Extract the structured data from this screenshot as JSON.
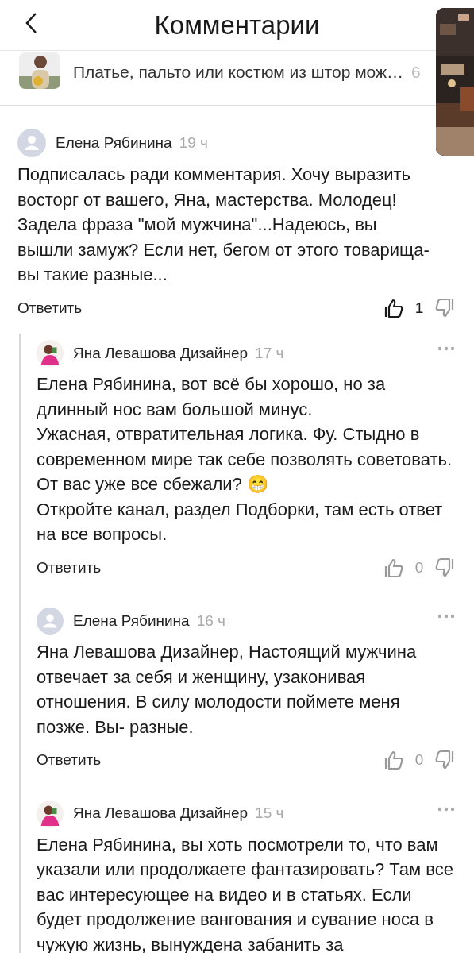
{
  "header": {
    "title": "Комментарии"
  },
  "article": {
    "title": "Платье, пальто или костюм из штор мож…",
    "extra": "6"
  },
  "comment": {
    "author": "Елена Рябинина",
    "kind": "placeholder",
    "time": "19 ч",
    "text": "Подписалась ради комментария. Хочу выразить восторг от вашего, Яна, мастерства. Молодец! Задела фраза \"мой мужчина\"...Надеюсь, вы вышли замуж? Если нет, бегом от этого товарища- вы такие разные...",
    "reply": "Ответить",
    "likes": "1",
    "liked": true
  },
  "replies": [
    {
      "author": "Яна Левашова Дизайнер",
      "time": "17 ч",
      "text": "Елена Рябинина, вот всё бы хорошо, но за длинный нос вам большой минус.\nУжасная, отвратительная логика. Фу. Стыдно в современном мире так себе позволять советовать.\nОт вас уже все сбежали? 😁\nОткройте канал, раздел Подборки, там есть ответ на все вопросы.",
      "reply": "Ответить",
      "likes": "0",
      "liked": false
    },
    {
      "author": "Елена Рябинина",
      "kind": "placeholder",
      "time": "16 ч",
      "text": "Яна Левашова Дизайнер, Настоящий мужчина отвечает за себя и женщину, узаконивая отношения. В силу молодости поймете меня позже. Вы- разные.",
      "reply": "Ответить",
      "likes": "0",
      "liked": false
    },
    {
      "author": "Яна Левашова Дизайнер",
      "time": "15 ч",
      "text": "Елена Рябинина, вы хоть посмотрели то, что вам указали или продолжаете фантазировать? Там все вас интересующее на видео и в статьях. Если будет продолжение вангования и сувание носа в чужую жизнь, вынуждена забанить за"
    }
  ]
}
